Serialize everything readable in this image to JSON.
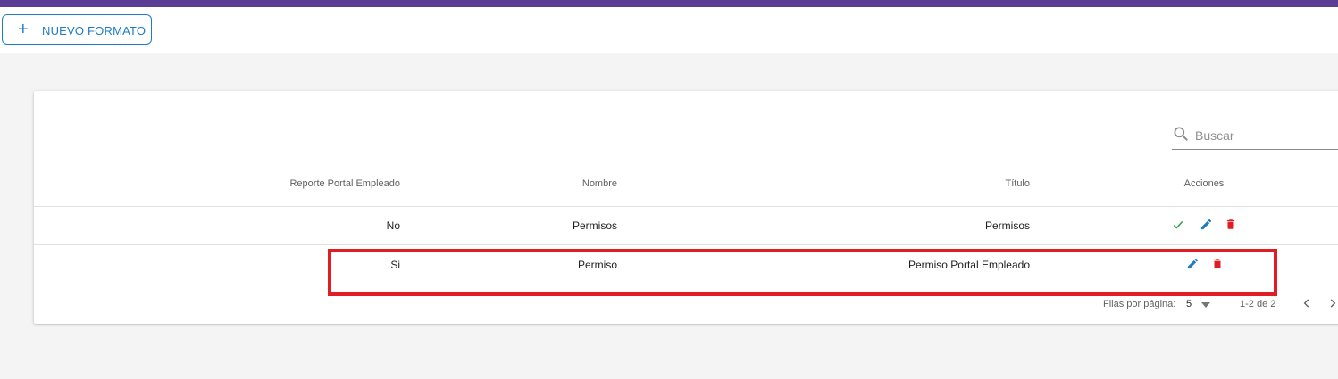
{
  "toolbar": {
    "new_button_label": "NUEVO FORMATO",
    "new_button_icon": "plus-icon"
  },
  "search": {
    "placeholder": "Buscar",
    "icon": "search-icon"
  },
  "table": {
    "headers": {
      "reporte": "Reporte Portal Empleado",
      "nombre": "Nombre",
      "titulo": "Título",
      "acciones": "Acciones"
    },
    "rows": [
      {
        "reporte": "No",
        "nombre": "Permisos",
        "titulo": "Permisos",
        "actions": [
          "check-icon",
          "edit-icon",
          "delete-icon"
        ]
      },
      {
        "reporte": "Si",
        "nombre": "Permiso",
        "titulo": "Permiso Portal Empleado",
        "actions": [
          "edit-icon",
          "delete-icon"
        ]
      }
    ]
  },
  "pagination": {
    "rows_per_page_label": "Filas por página:",
    "rows_per_page_value": "5",
    "range": "1-2 de 2"
  },
  "colors": {
    "topbar": "#5b3d96",
    "primary": "#1e7bc4",
    "delete": "#e01c24",
    "check": "#2e9e4f",
    "highlight": "#e01c24"
  }
}
